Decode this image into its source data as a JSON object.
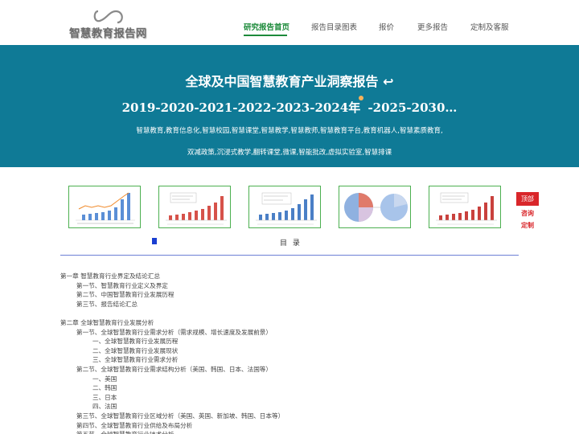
{
  "header": {
    "logo_text": "智慧教育报告网",
    "nav": [
      {
        "label": "研究报告首页",
        "active": true
      },
      {
        "label": "报告目录图表",
        "active": false
      },
      {
        "label": "报价",
        "active": false
      },
      {
        "label": "更多报告",
        "active": false
      },
      {
        "label": "定制及客服",
        "active": false
      }
    ]
  },
  "banner": {
    "title": "全球及中国智慧教育产业洞察报告 ↩",
    "years_part1": "2019-2020-2021-2022-2023-2024年",
    "years_part2": " -2025-2030…",
    "keywords_line1": "智慧教育,教育信息化,智慧校园,智慧课堂,智慧教学,智慧教师,智慧教育平台,教育机器人,智慧素质教育,",
    "keywords_line2": "双减政策,沉浸式教学,翻转课堂,微课,智能批改,虚拟实验室,智慧排课"
  },
  "side_float": {
    "top": "顶部",
    "consult": "咨询",
    "custom": "定制"
  },
  "toc": {
    "heading": "目 录",
    "rows": [
      {
        "level": 1,
        "text": "第一章 智慧教育行业界定及结论汇总"
      },
      {
        "level": 2,
        "text": "第一节、智慧教育行业定义及界定"
      },
      {
        "level": 2,
        "text": "第二节、中国智慧教育行业发展历程"
      },
      {
        "level": 2,
        "text": "第三节、报告结论汇总"
      },
      {
        "level": 0,
        "text": ""
      },
      {
        "level": 1,
        "text": "第二章 全球智慧教育行业发展分析"
      },
      {
        "level": 2,
        "text": "第一节、全球智慧教育行业需求分析（需求规模、增长速度及发展前景）"
      },
      {
        "level": 3,
        "text": "一、全球智慧教育行业发展历程"
      },
      {
        "level": 3,
        "text": "二、全球智慧教育行业发展现状"
      },
      {
        "level": 3,
        "text": "三、全球智慧教育行业需求分析"
      },
      {
        "level": 2,
        "text": "第二节、全球智慧教育行业需求结构分析（美国、韩国、日本、法国等）"
      },
      {
        "level": 3,
        "text": "一、美国"
      },
      {
        "level": 3,
        "text": "二、韩国"
      },
      {
        "level": 3,
        "text": "三、日本"
      },
      {
        "level": 3,
        "text": "四、法国"
      },
      {
        "level": 2,
        "text": "第三节、全球智慧教育行业区域分析（美国、英国、新加坡、韩国、日本等）"
      },
      {
        "level": 2,
        "text": "第四节、全球智慧教育行业供给及布局分析"
      },
      {
        "level": 2,
        "text": "第五节、全球智慧教育行业技术分析"
      }
    ]
  },
  "colors": {
    "banner_bg": "#0f7a96",
    "accent_green": "#1c8a3a",
    "side_red": "#d9262a",
    "toc_line": "#6c7fd6"
  }
}
